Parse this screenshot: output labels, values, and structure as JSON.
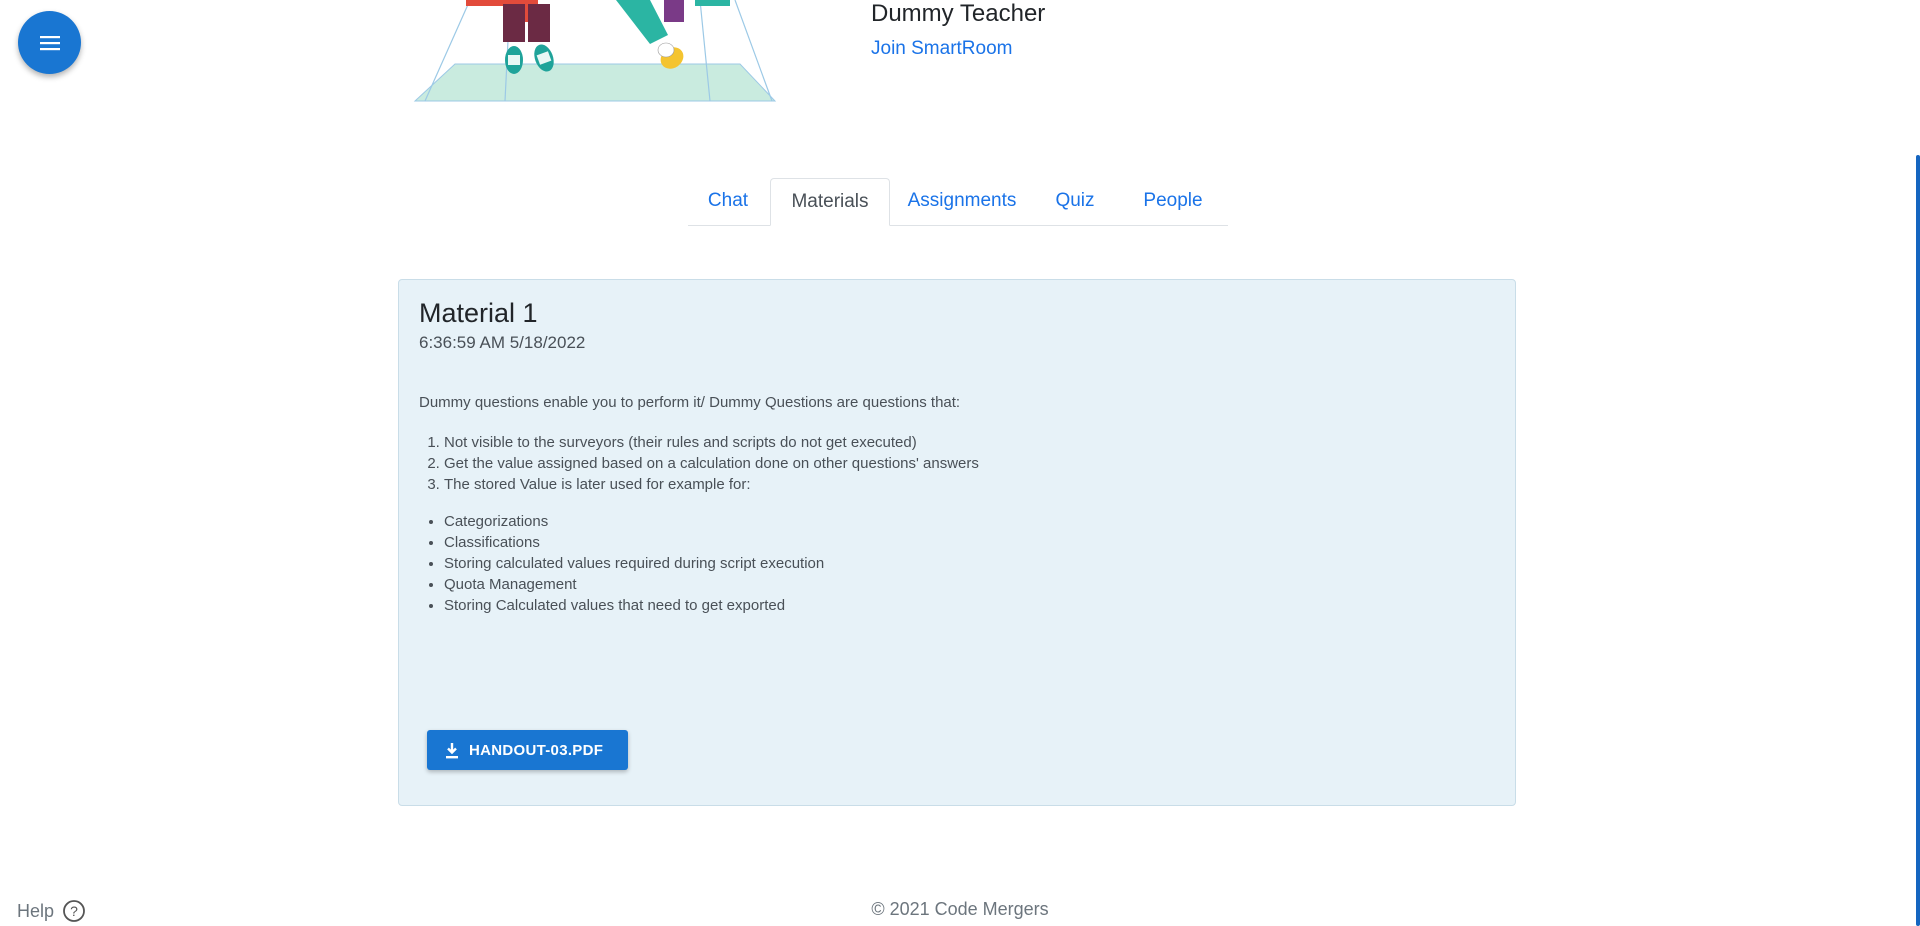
{
  "header": {
    "teacher_name": "Dummy Teacher",
    "join_link": "Join SmartRoom"
  },
  "tabs": [
    {
      "label": "Chat",
      "active": false
    },
    {
      "label": "Materials",
      "active": true
    },
    {
      "label": "Assignments",
      "active": false
    },
    {
      "label": "Quiz",
      "active": false
    },
    {
      "label": "People",
      "active": false
    }
  ],
  "material": {
    "title": "Material 1",
    "date": "6:36:59 AM 5/18/2022",
    "intro": "Dummy questions enable you to perform it/ Dummy Questions are questions that:",
    "ordered_items": [
      "Not visible to the surveyors (their rules and scripts do not get executed)",
      "Get the value assigned based on a calculation done on other questions' answers",
      "The stored Value is later used for example for:"
    ],
    "bullet_items": [
      "Categorizations",
      "Classifications",
      "Storing calculated values required during script execution",
      "Quota Management",
      "Storing Calculated values that need to get exported"
    ],
    "download_label": "HANDOUT-03.PDF"
  },
  "footer": {
    "help_label": "Help",
    "copyright": "© 2021 Code Mergers"
  },
  "colors": {
    "primary": "#1976d2",
    "link": "#1a73e8",
    "card_bg": "#e7f2f8"
  },
  "icons": {
    "fab": "menu-icon",
    "download": "download-icon",
    "help": "help-circle-icon"
  }
}
